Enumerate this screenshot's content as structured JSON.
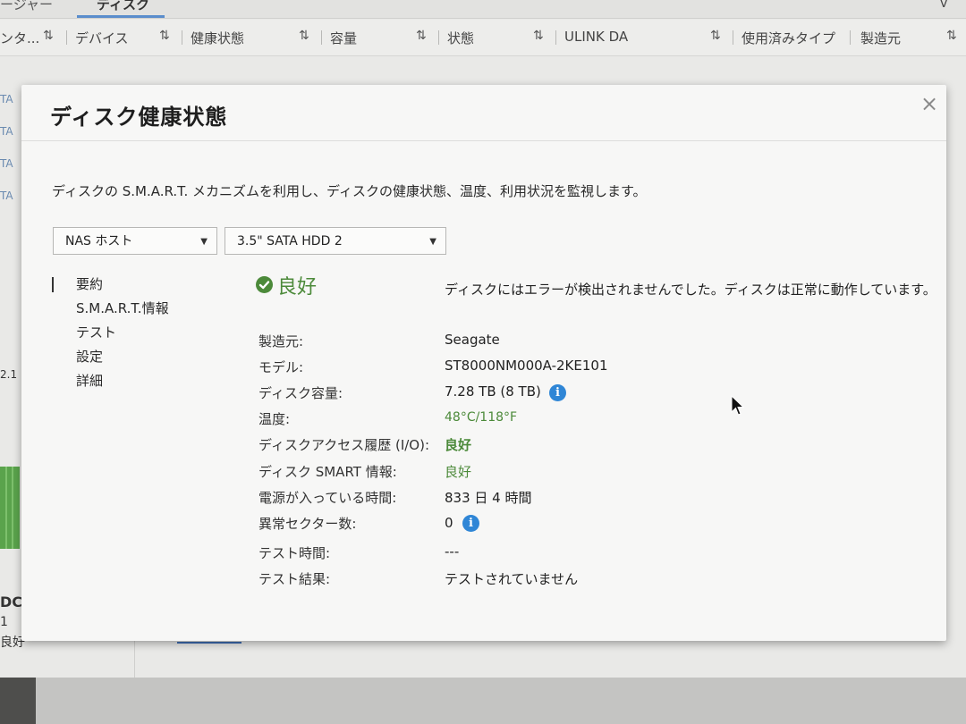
{
  "background": {
    "tabs": [
      "ージャー",
      "ディスク"
    ],
    "columns": [
      {
        "label": "ンタ...",
        "sort": "⇅"
      },
      {
        "label": "デバイス",
        "sort": "⇅"
      },
      {
        "label": "健康状態",
        "sort": "⇅"
      },
      {
        "label": "容量",
        "sort": "⇅"
      },
      {
        "label": "状態",
        "sort": "⇅"
      },
      {
        "label": "ULINK DA",
        "sort": "⇅"
      },
      {
        "label": "使用済みタイプ",
        "sort": ""
      },
      {
        "label": "製造元",
        "sort": "⇅"
      }
    ],
    "edge_left": [
      "TA",
      "TA",
      "TA",
      "TA"
    ],
    "edge_value": "2.1",
    "bottom_left": [
      "DC",
      "1",
      "良好"
    ]
  },
  "modal": {
    "title": "ディスク健康状態",
    "close_label": "×",
    "description": "ディスクの S.M.A.R.T. メカニズムを利用し、ディスクの健康状態、温度、利用状況を監視します。",
    "host_select": "NAS ホスト",
    "disk_select": "3.5\" SATA HDD 2",
    "nav": [
      "要約",
      "S.M.A.R.T.情報",
      "テスト",
      "設定",
      "詳細"
    ],
    "status": "良好",
    "status_message": "ディスクにはエラーが検出されませんでした。ディスクは正常に動作しています。",
    "fields": {
      "manufacturer_label": "製造元:",
      "manufacturer": "Seagate",
      "model_label": "モデル:",
      "model": "ST8000NM000A-2KE101",
      "capacity_label": "ディスク容量:",
      "capacity": "7.28 TB (8 TB)",
      "temperature_label": "温度:",
      "temperature": "48°C/118°F",
      "io_history_label": "ディスクアクセス履歴 (I/O):",
      "io_history": "良好",
      "smart_label": "ディスク SMART 情報:",
      "smart": "良好",
      "power_on_label": "電源が入っている時間:",
      "power_on": "833 日 4 時間",
      "bad_sectors_label": "異常セクター数:",
      "bad_sectors": "0",
      "test_time_label": "テスト時間:",
      "test_time": "---",
      "test_result_label": "テスト結果:",
      "test_result": "テストされていません"
    },
    "info_glyph": "i",
    "colors": {
      "good": "#4c8a3a",
      "info": "#2f86d6"
    }
  }
}
